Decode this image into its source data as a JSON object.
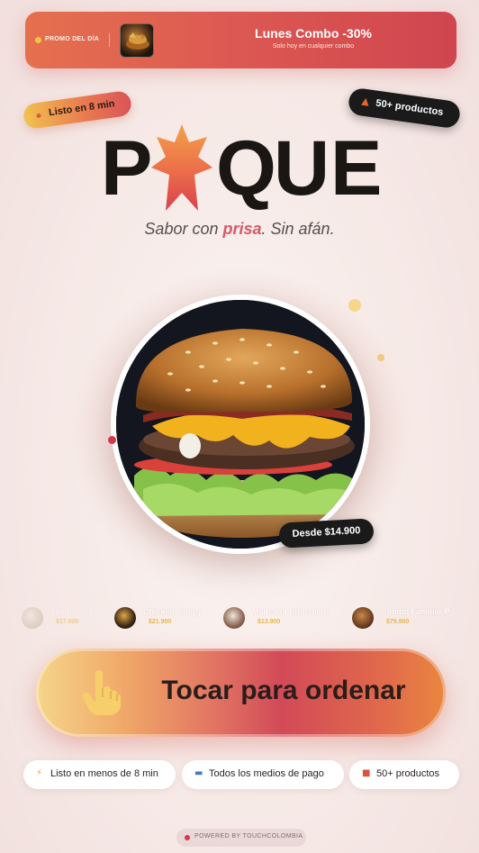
{
  "promo": {
    "tag": "PROMO DEL DÍA",
    "title": "Lunes Combo -30%",
    "subtitle": "Solo hoy en cualquier combo"
  },
  "badges": {
    "ready": "Listo en 8 min",
    "products": "50+ productos"
  },
  "logo": {
    "text": "PQUE",
    "letters": [
      "P",
      "Q",
      "U",
      "E"
    ]
  },
  "tagline": {
    "before": "Sabor con ",
    "accent": "prisa",
    "after": ". Sin afán."
  },
  "hero": {
    "price_badge": "Desde $14.900"
  },
  "carousel": [
    {
      "name": "Tenders x3",
      "price": "$17.900"
    },
    {
      "name": "Chicken Crispy",
      "price": "$21.900"
    },
    {
      "name": "Malteada Chocolate",
      "price": "$13.900"
    },
    {
      "name": "Combo Familiar P",
      "price": "$79.900"
    }
  ],
  "cta": {
    "label": "Tocar para ordenar"
  },
  "features": [
    {
      "icon": "lightning-icon",
      "label": "Listo en menos de 8 min"
    },
    {
      "icon": "card-icon",
      "label": "Todos los medios de pago"
    },
    {
      "icon": "gift-icon",
      "label": "50+ productos"
    }
  ],
  "footer": {
    "text": "POWERED BY TOUCHCOLOMBIA"
  },
  "colors": {
    "accent_red": "#d4394a",
    "accent_orange": "#e8774f",
    "accent_yellow": "#f2c14e",
    "dark": "#1b1a1a"
  }
}
